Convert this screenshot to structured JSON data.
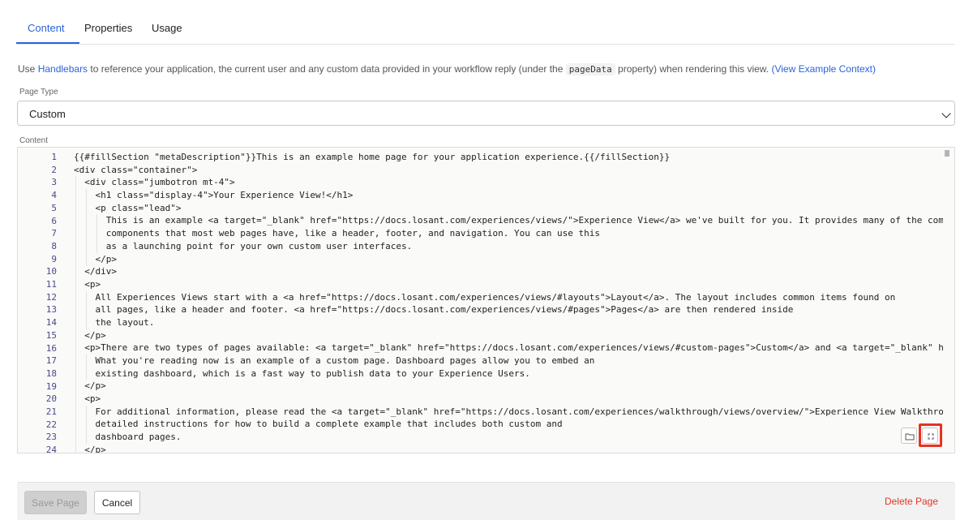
{
  "tabs": [
    {
      "label": "Content",
      "active": true
    },
    {
      "label": "Properties",
      "active": false
    },
    {
      "label": "Usage",
      "active": false
    }
  ],
  "description": {
    "prefix": "Use ",
    "handlebars_link": "Handlebars",
    "middle": " to reference your application, the current user and any custom data provided in your workflow reply (under the ",
    "code": "pageData",
    "suffix": " property) when rendering this view. ",
    "example_link": "(View Example Context)"
  },
  "page_type": {
    "label": "Page Type",
    "value": "Custom"
  },
  "content": {
    "label": "Content",
    "lines": [
      {
        "n": "1",
        "text": "{{#fillSection \"metaDescription\"}}This is an example home page for your application experience.{{/fillSection}}"
      },
      {
        "n": "2",
        "text": "<div class=\"container\">"
      },
      {
        "n": "3",
        "text": "  <div class=\"jumbotron mt-4\">"
      },
      {
        "n": "4",
        "text": "    <h1 class=\"display-4\">Your Experience View!</h1>"
      },
      {
        "n": "5",
        "text": "    <p class=\"lead\">"
      },
      {
        "n": "6",
        "text": "      This is an example <a target=\"_blank\" href=\"https://docs.losant.com/experiences/views/\">Experience View</a> we've built for you. It provides many of the common"
      },
      {
        "n": "7",
        "text": "      components that most web pages have, like a header, footer, and navigation. You can use this"
      },
      {
        "n": "8",
        "text": "      as a launching point for your own custom user interfaces."
      },
      {
        "n": "9",
        "text": "    </p>"
      },
      {
        "n": "10",
        "text": "  </div>"
      },
      {
        "n": "11",
        "text": "  <p>"
      },
      {
        "n": "12",
        "text": "    All Experiences Views start with a <a href=\"https://docs.losant.com/experiences/views/#layouts\">Layout</a>. The layout includes common items found on"
      },
      {
        "n": "13",
        "text": "    all pages, like a header and footer. <a href=\"https://docs.losant.com/experiences/views/#pages\">Pages</a> are then rendered inside"
      },
      {
        "n": "14",
        "text": "    the layout."
      },
      {
        "n": "15",
        "text": "  </p>"
      },
      {
        "n": "16",
        "text": "  <p>There are two types of pages available: <a target=\"_blank\" href=\"https://docs.losant.com/experiences/views/#custom-pages\">Custom</a> and <a target=\"_blank\" href=\"https:"
      },
      {
        "n": "17",
        "text": "    What you're reading now is an example of a custom page. Dashboard pages allow you to embed an"
      },
      {
        "n": "18",
        "text": "    existing dashboard, which is a fast way to publish data to your Experience Users."
      },
      {
        "n": "19",
        "text": "  </p>"
      },
      {
        "n": "20",
        "text": "  <p>"
      },
      {
        "n": "21",
        "text": "    For additional information, please read the <a target=\"_blank\" href=\"https://docs.losant.com/experiences/walkthrough/views/overview/\">Experience View Walkthrough</a>, wh"
      },
      {
        "n": "22",
        "text": "    detailed instructions for how to build a complete example that includes both custom and"
      },
      {
        "n": "23",
        "text": "    dashboard pages."
      },
      {
        "n": "24",
        "text": "  </p>"
      }
    ]
  },
  "editor_buttons": {
    "folder_icon": "folder-icon",
    "fullscreen_icon": "fullscreen-icon"
  },
  "footer": {
    "save_label": "Save Page",
    "cancel_label": "Cancel",
    "delete_label": "Delete Page"
  },
  "colors": {
    "accent": "#2b63d9",
    "danger": "#e0362a",
    "highlight": "#e8321f"
  }
}
